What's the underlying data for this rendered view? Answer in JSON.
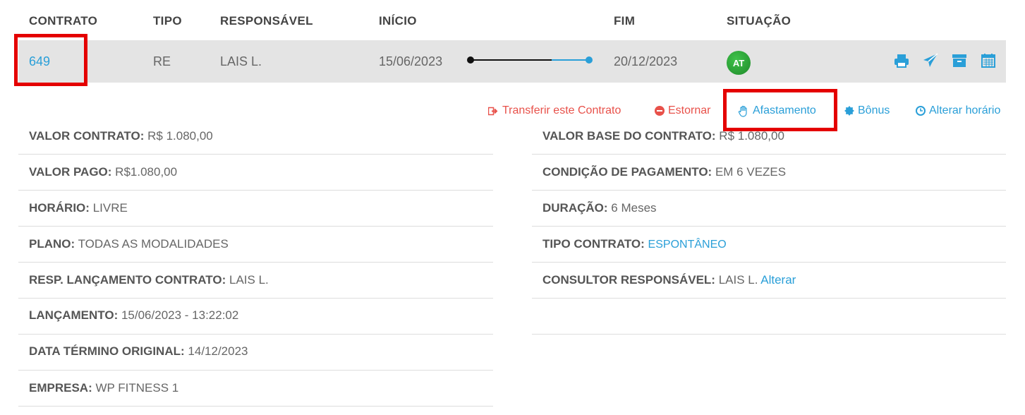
{
  "headers": {
    "contrato": "CONTRATO",
    "tipo": "TIPO",
    "responsavel": "RESPONSÁVEL",
    "inicio": "INÍCIO",
    "fim": "FIM",
    "situacao": "SITUAÇÃO"
  },
  "row": {
    "contrato": "649",
    "tipo": "RE",
    "responsavel": "LAIS L.",
    "inicio": "15/06/2023",
    "fim": "20/12/2023",
    "situacao": "AT",
    "progress": 0.67
  },
  "actions": {
    "transferir": "Transferir este Contrato",
    "estornar": "Estornar",
    "afastamento": "Afastamento",
    "bonus": "Bônus",
    "alterar_horario": "Alterar horário"
  },
  "left": [
    {
      "label": "VALOR CONTRATO:",
      "value": "R$ 1.080,00"
    },
    {
      "label": "VALOR PAGO:",
      "value": "R$1.080,00"
    },
    {
      "label": "HORÁRIO:",
      "value": "LIVRE"
    },
    {
      "label": "PLANO:",
      "value": "TODAS AS MODALIDADES"
    },
    {
      "label": "RESP. LANÇAMENTO CONTRATO:",
      "value": "LAIS L."
    },
    {
      "label": "LANÇAMENTO:",
      "value": "15/06/2023 - 13:22:02"
    },
    {
      "label": "DATA TÉRMINO ORIGINAL:",
      "value": "14/12/2023"
    },
    {
      "label": "EMPRESA:",
      "value": "WP FITNESS 1"
    }
  ],
  "right": [
    {
      "label": "VALOR BASE DO CONTRATO:",
      "value": "R$ 1.080,00"
    },
    {
      "label": "CONDIÇÃO DE PAGAMENTO:",
      "value": "EM 6 VEZES"
    },
    {
      "label": "DURAÇÃO:",
      "value": "6 Meses"
    },
    {
      "label": "TIPO CONTRATO:",
      "value": "ESPONTÂNEO"
    },
    {
      "label": "CONSULTOR RESPONSÁVEL:",
      "value": "LAIS L.",
      "link": "Alterar"
    }
  ],
  "colors": {
    "accent": "#2a9fd8",
    "danger": "#e8514a",
    "status": "#2ea83a",
    "highlight": "#e40000"
  },
  "icons": [
    "print-icon",
    "send-icon",
    "archive-icon",
    "calendar-icon"
  ]
}
